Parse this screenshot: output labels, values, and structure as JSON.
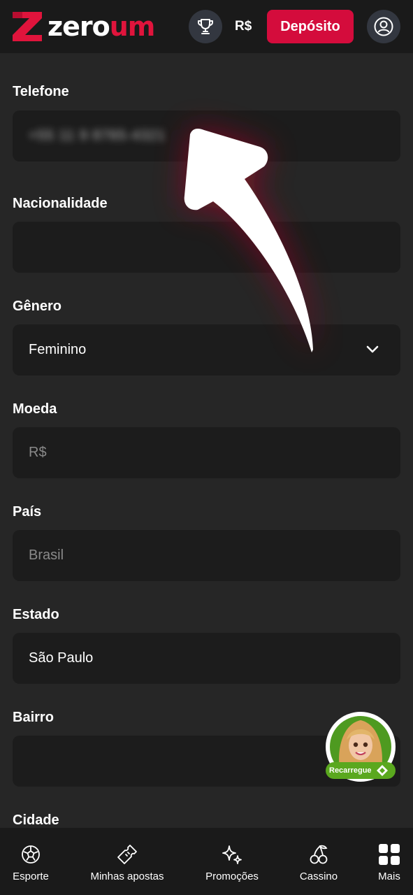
{
  "header": {
    "logo": {
      "text_part1": "zero",
      "text_part2": "um",
      "mark_icon": "z-logo-icon"
    },
    "trophy_icon": "trophy-icon",
    "balance": "R$",
    "deposit_label": "Depósito",
    "profile_icon": "user-circle-icon"
  },
  "form": {
    "telefone": {
      "label": "Telefone",
      "value": "+55 11 9 8765-4321"
    },
    "nacionalidade": {
      "label": "Nacionalidade",
      "value": ""
    },
    "genero": {
      "label": "Gênero",
      "value": "Feminino"
    },
    "moeda": {
      "label": "Moeda",
      "value": "R$"
    },
    "pais": {
      "label": "País",
      "value": "Brasil"
    },
    "estado": {
      "label": "Estado",
      "value": "São Paulo"
    },
    "bairro": {
      "label": "Bairro",
      "value": ""
    },
    "cidade": {
      "label": "Cidade"
    }
  },
  "chat_widget": {
    "label": "Recarregue"
  },
  "bottom_nav": {
    "items": [
      {
        "label": "Esporte",
        "icon": "soccer-ball-icon"
      },
      {
        "label": "Minhas apostas",
        "icon": "ticket-icon"
      },
      {
        "label": "Promoções",
        "icon": "sparkle-icon"
      },
      {
        "label": "Cassino",
        "icon": "cherries-icon"
      },
      {
        "label": "Mais",
        "icon": "grid-icon"
      }
    ]
  },
  "colors": {
    "brand_red": "#d40c3c",
    "background": "#262626",
    "header": "#1a1a1a",
    "field": "#1c1c1c",
    "badge_green": "#5aa81e"
  }
}
